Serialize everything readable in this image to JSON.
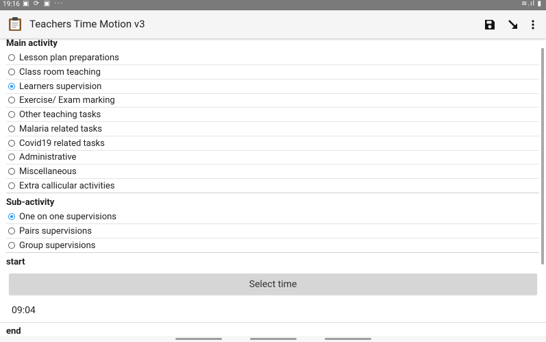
{
  "statusbar": {
    "time": "19:16",
    "left_icons": "▣ ⟳ ▣ ···",
    "right_icons": "≋.ıl ▮"
  },
  "appbar": {
    "title": "Teachers Time Motion v3"
  },
  "main_activity": {
    "title": "Main activity",
    "options": [
      {
        "label": "Lesson plan preparations",
        "checked": false
      },
      {
        "label": "Class room teaching",
        "checked": false
      },
      {
        "label": "Learners supervision",
        "checked": true
      },
      {
        "label": "Exercise/ Exam marking",
        "checked": false
      },
      {
        "label": "Other teaching tasks",
        "checked": false
      },
      {
        "label": "Malaria related tasks",
        "checked": false
      },
      {
        "label": "Covid19 related tasks",
        "checked": false
      },
      {
        "label": "Administrative",
        "checked": false
      },
      {
        "label": "Miscellaneous",
        "checked": false
      },
      {
        "label": "Extra callicular activities",
        "checked": false
      }
    ]
  },
  "sub_activity": {
    "title": "Sub-activity",
    "options": [
      {
        "label": "One on one supervisions",
        "checked": true
      },
      {
        "label": "Pairs supervisions",
        "checked": false
      },
      {
        "label": "Group supervisions",
        "checked": false
      }
    ]
  },
  "start": {
    "title": "start",
    "button_label": "Select time",
    "value": "09:04"
  },
  "end": {
    "title": "end"
  },
  "colors": {
    "accent": "#2196f3",
    "statusbar": "#7a7a7a",
    "button": "#d6d6d6"
  }
}
